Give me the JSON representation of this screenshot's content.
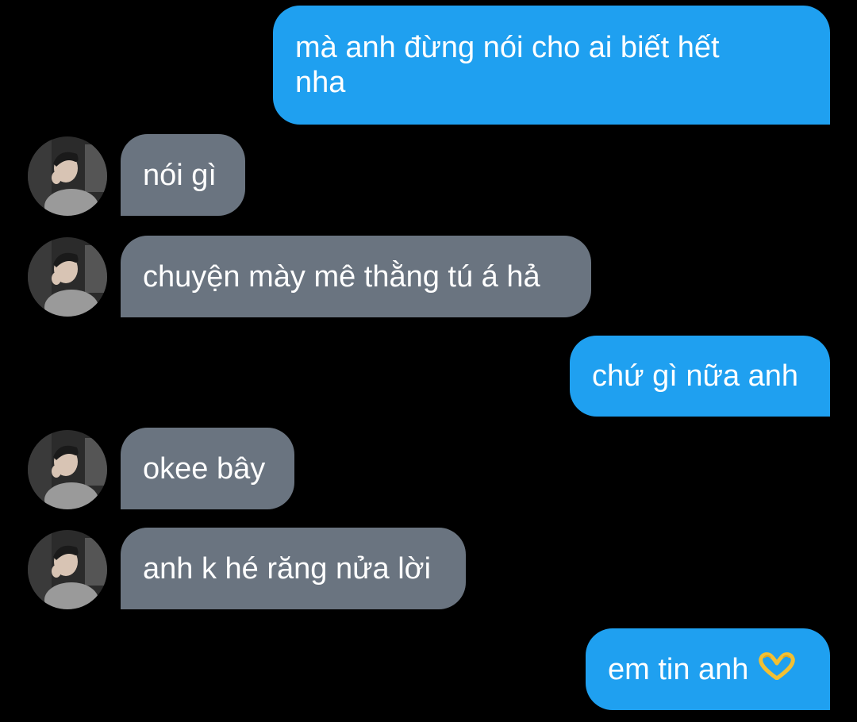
{
  "colors": {
    "background": "#000000",
    "sent_bubble": "#1fa0f0",
    "received_bubble": "#6a7480",
    "text": "#ffffff"
  },
  "messages": [
    {
      "direction": "sent",
      "text": "mà anh đừng nói cho ai biết hết nha"
    },
    {
      "direction": "received",
      "text": "nói gì",
      "avatar": "contact-avatar"
    },
    {
      "direction": "received",
      "text": "chuyện mày mê thằng tú á hả",
      "avatar": "contact-avatar"
    },
    {
      "direction": "sent",
      "text": "chứ gì nữa anh"
    },
    {
      "direction": "received",
      "text": "okee bây",
      "avatar": "contact-avatar"
    },
    {
      "direction": "received",
      "text": "anh k hé răng nửa lời",
      "avatar": "contact-avatar"
    },
    {
      "direction": "sent",
      "text": "em tin anh",
      "emoji": "heart-hands-icon"
    }
  ]
}
